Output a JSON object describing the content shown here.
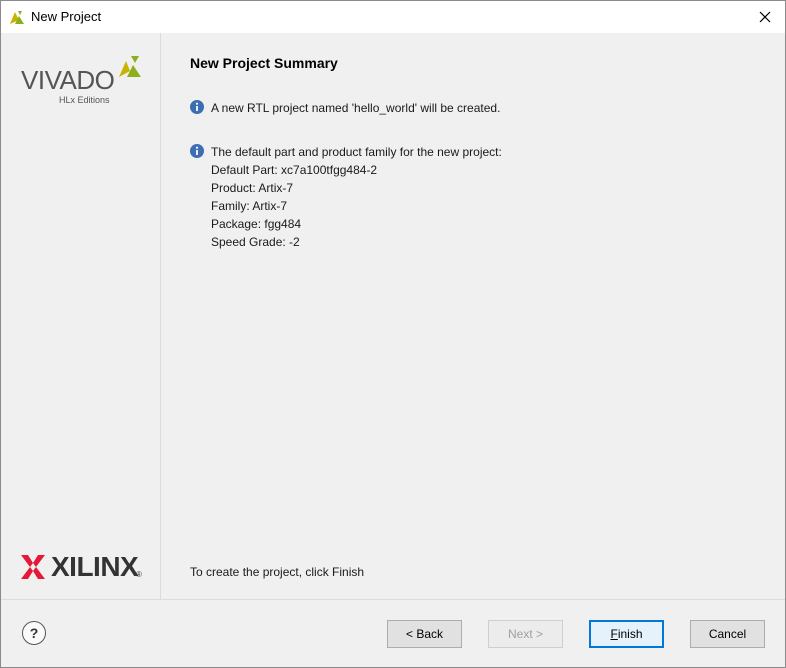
{
  "window": {
    "title": "New Project",
    "title_icon": "vivado-leaf-icon",
    "close_icon": "close-icon"
  },
  "sidebar": {
    "vivado_logo": {
      "word": "VIVADO",
      "sub": "HLx Editions"
    },
    "xilinx_logo": {
      "word": "XILINX",
      "mark": "®"
    }
  },
  "main": {
    "page_title": "New Project Summary",
    "info1": "A new RTL project named 'hello_world' will be created.",
    "info2": "The default part and product family for the new project:",
    "details": [
      "Default Part: xc7a100tfgg484-2",
      "Product: Artix-7",
      "Family: Artix-7",
      "Package: fgg484",
      "Speed Grade: -2"
    ],
    "footer_note": "To create the project, click Finish"
  },
  "buttons": {
    "help": "?",
    "back": "< Back",
    "next": "Next >",
    "finish": "Finish",
    "cancel": "Cancel"
  },
  "colors": {
    "info_icon": "#3c6eb4",
    "vivado_green": "#8cb01c",
    "vivado_yellow": "#c8b400",
    "xilinx_red": "#e31937",
    "finish_border": "#0078d7"
  }
}
